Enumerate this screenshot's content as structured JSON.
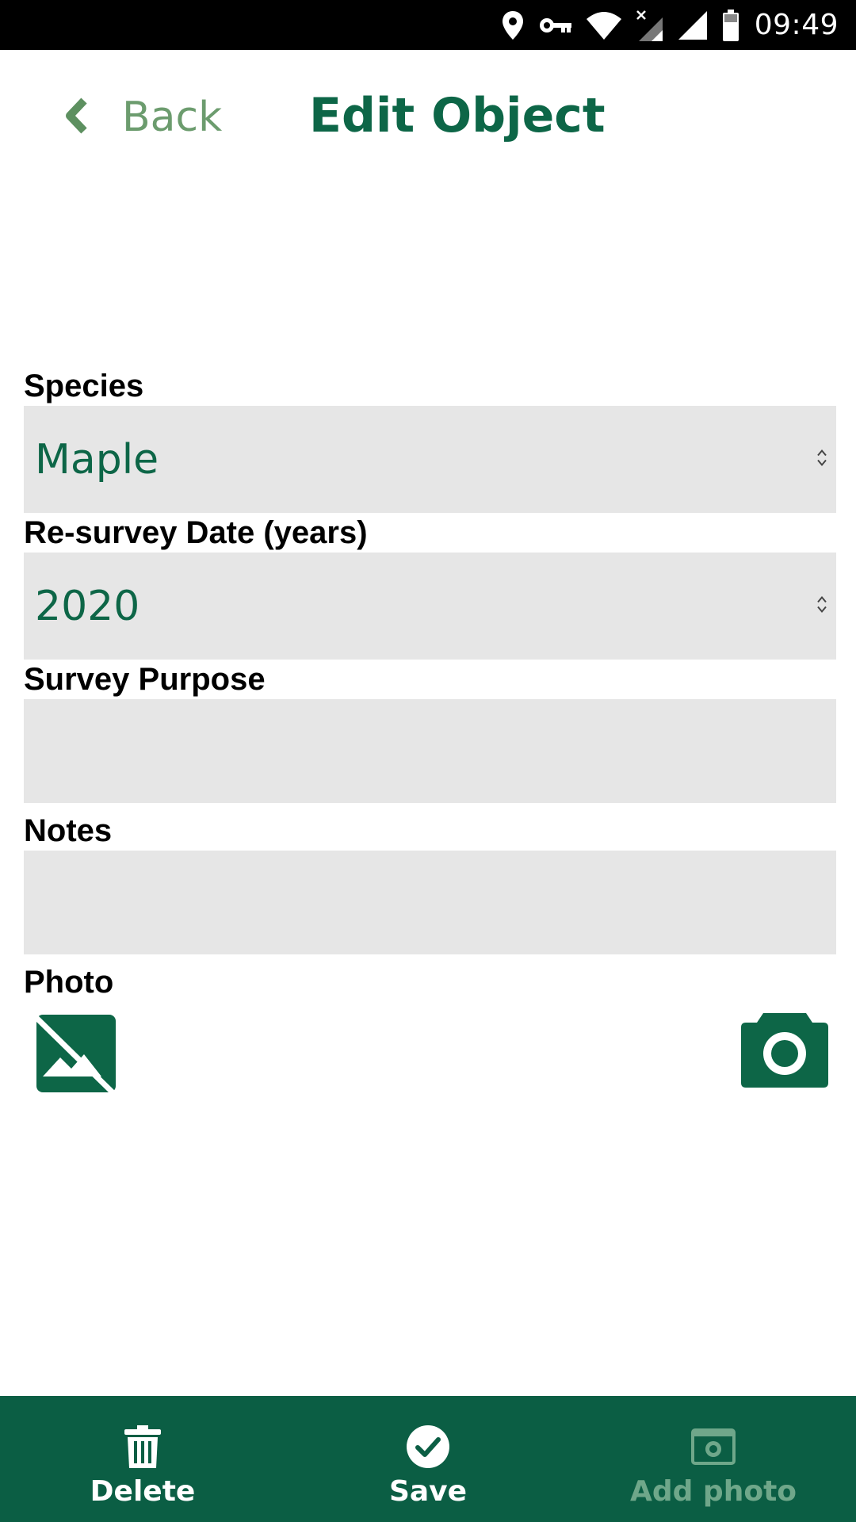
{
  "status_bar": {
    "time": "09:49",
    "icons": [
      "location-icon",
      "vpn-key-icon",
      "wifi-icon",
      "no-sim-signal-icon",
      "signal-icon",
      "battery-icon"
    ]
  },
  "header": {
    "back_label": "Back",
    "title": "Edit Object"
  },
  "form": {
    "species": {
      "label": "Species",
      "value": "Maple"
    },
    "resurvey": {
      "label": "Re-survey Date (years)",
      "value": "2020"
    },
    "purpose": {
      "label": "Survey Purpose",
      "value": ""
    },
    "notes": {
      "label": "Notes",
      "value": ""
    },
    "photo": {
      "label": "Photo"
    }
  },
  "bottom_bar": {
    "delete_label": "Delete",
    "save_label": "Save",
    "add_photo_label": "Add photo"
  },
  "colors": {
    "brand_green": "#0d6647",
    "bottom_bar": "#0b5e44",
    "back_green": "#6c9c6e",
    "field_bg": "#e6e6e6",
    "disabled_label": "#6fa78a"
  }
}
